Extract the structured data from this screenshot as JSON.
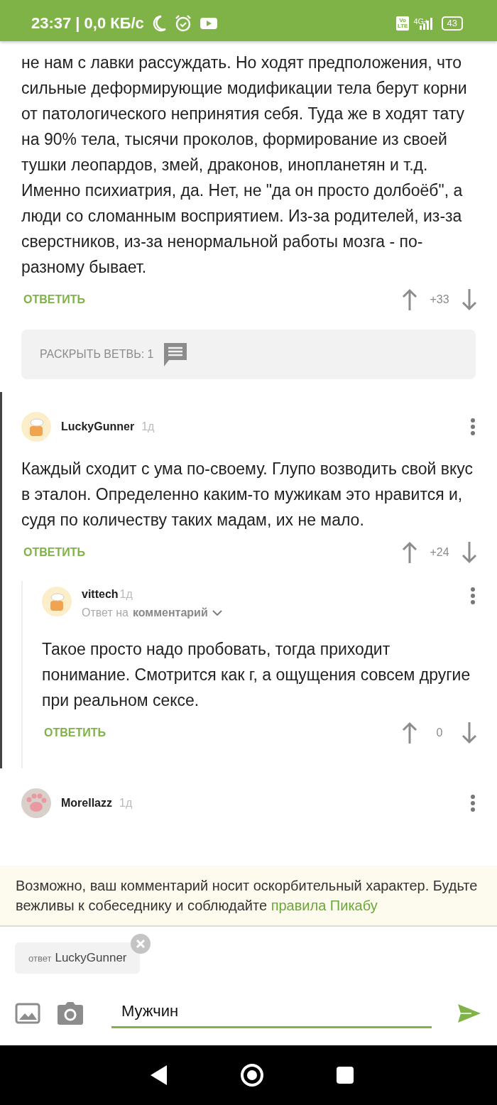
{
  "status_bar": {
    "time": "23:37",
    "speed": "| 0,0 КБ/с",
    "volte": [
      "Vo",
      "LTE"
    ],
    "network": "4G+",
    "battery": "43"
  },
  "comments": [
    {
      "text": "не нам с лавки рассуждать. Но ходят предположения, что сильные деформирующие модификации тела берут корни от патологического непринятия себя. Туда же в ходят тату на 90% тела, тысячи проколов, формирование из своей тушки леопардов, змей, драконов, инопланетян и т.д. Именно психиатрия, да. Нет, не \"да он просто долбоёб\", а люди со сломанным восприятием. Из-за родителей, из-за сверстников, из-за ненормальной работы мозга - по-разному бывает.",
      "reply": "ОТВЕТИТЬ",
      "rating": "+33",
      "expand": "РАСКРЫТЬ ВЕТВЬ: 1",
      "highlighted": false
    },
    {
      "author": "LuckyGunner",
      "age": "1д",
      "avatar": {
        "kind": "chef"
      },
      "highlighted": true,
      "text": "Каждый сходит с ума по-своему. Глупо возводить свой вкус в эталон. Определенно каким-то мужикам это нравится и, судя по количеству таких мадам, их не мало.",
      "reply": "ОТВЕТИТЬ",
      "rating": "+24",
      "children": [
        {
          "author": "vittech",
          "age": "1д",
          "avatar": {
            "kind": "chef"
          },
          "reply_to_prefix": "Ответ на",
          "reply_to": "комментарий",
          "text": "Такое просто надо пробовать, тогда приходит понимание. Смотрится как г, а ощущения совсем другие при реальном сексе.",
          "reply": "ОТВЕТИТЬ",
          "rating": "0"
        }
      ]
    },
    {
      "author": "Morellazz",
      "age": "1д",
      "avatar": {
        "kind": "paw"
      },
      "highlighted": false
    }
  ],
  "warning": {
    "text": "Возможно, ваш комментарий носит оскорбительный характер. Будьте вежливы к собеседнику и соблюдайте ",
    "link": "правила Пикабу"
  },
  "reply_chip": {
    "prefix": "ответ",
    "name": "LuckyGunner"
  },
  "input": {
    "value": "Мужчин"
  }
}
